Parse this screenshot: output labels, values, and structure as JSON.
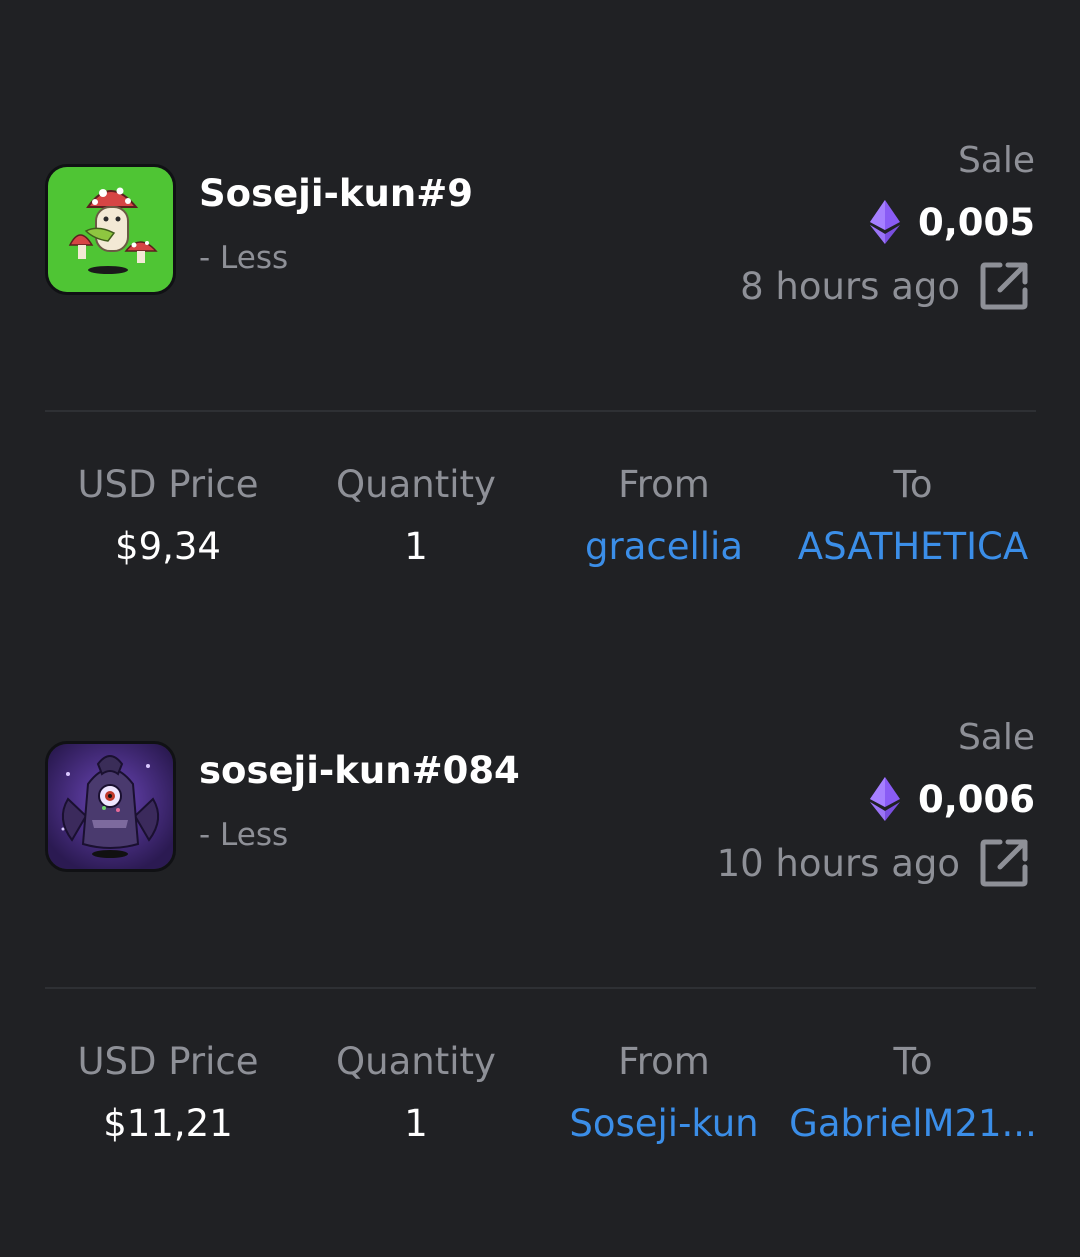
{
  "sales": [
    {
      "name": "Soseji-kun#9",
      "toggle_label": "- Less",
      "event_type": "Sale",
      "eth_value": "0,005",
      "time_ago": "8 hours ago",
      "usd_price_label": "USD Price",
      "usd_price": "$9,34",
      "quantity_label": "Quantity",
      "quantity": "1",
      "from_label": "From",
      "from": "gracellia",
      "to_label": "To",
      "to": "ASATHETICA"
    },
    {
      "name": "soseji-kun#084",
      "toggle_label": "- Less",
      "event_type": "Sale",
      "eth_value": "0,006",
      "time_ago": "10 hours ago",
      "usd_price_label": "USD Price",
      "usd_price": "$11,21",
      "quantity_label": "Quantity",
      "quantity": "1",
      "from_label": "From",
      "from": "Soseji-kun",
      "to_label": "To",
      "to": "GabrielM21..."
    }
  ],
  "colors": {
    "background": "#202124",
    "link": "#3b8ee8",
    "muted_text": "#8e9097",
    "eth_purple": "#8a5cf5"
  },
  "icons": {
    "currency": "ethereum-icon",
    "external": "external-link-icon"
  }
}
